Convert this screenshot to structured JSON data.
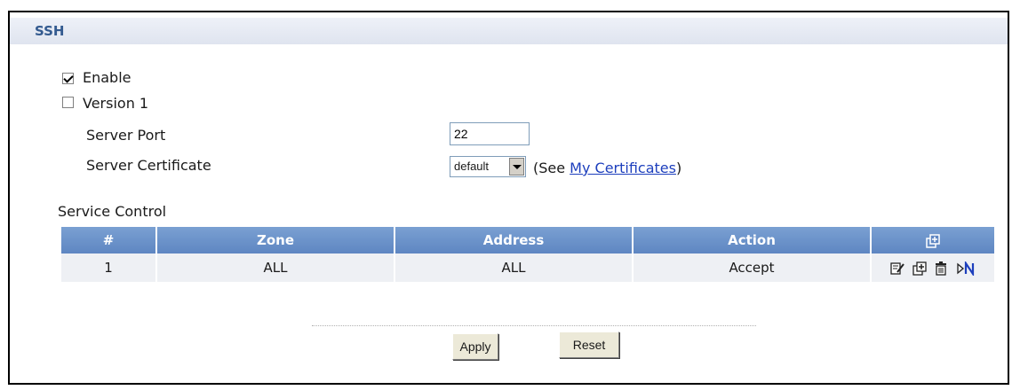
{
  "section": {
    "title": "SSH"
  },
  "general": {
    "enable_label": "Enable",
    "enable_checked": true,
    "version1_label": "Version 1",
    "version1_checked": false,
    "server_port_label": "Server Port",
    "server_port_value": "22",
    "server_cert_label": "Server Certificate",
    "server_cert_value": "default",
    "see_prefix": "(See ",
    "see_link": "My Certificates",
    "see_suffix": ")"
  },
  "service_control": {
    "label": "Service Control",
    "columns": [
      "#",
      "Zone",
      "Address",
      "Action"
    ],
    "rows": [
      {
        "index": "1",
        "zone": "ALL",
        "address": "ALL",
        "action": "Accept"
      }
    ],
    "row_icons": [
      "edit-icon",
      "insert-icon",
      "delete-icon",
      "move-icon"
    ],
    "header_icon": "add-icon"
  },
  "buttons": {
    "apply": "Apply",
    "reset": "Reset"
  }
}
